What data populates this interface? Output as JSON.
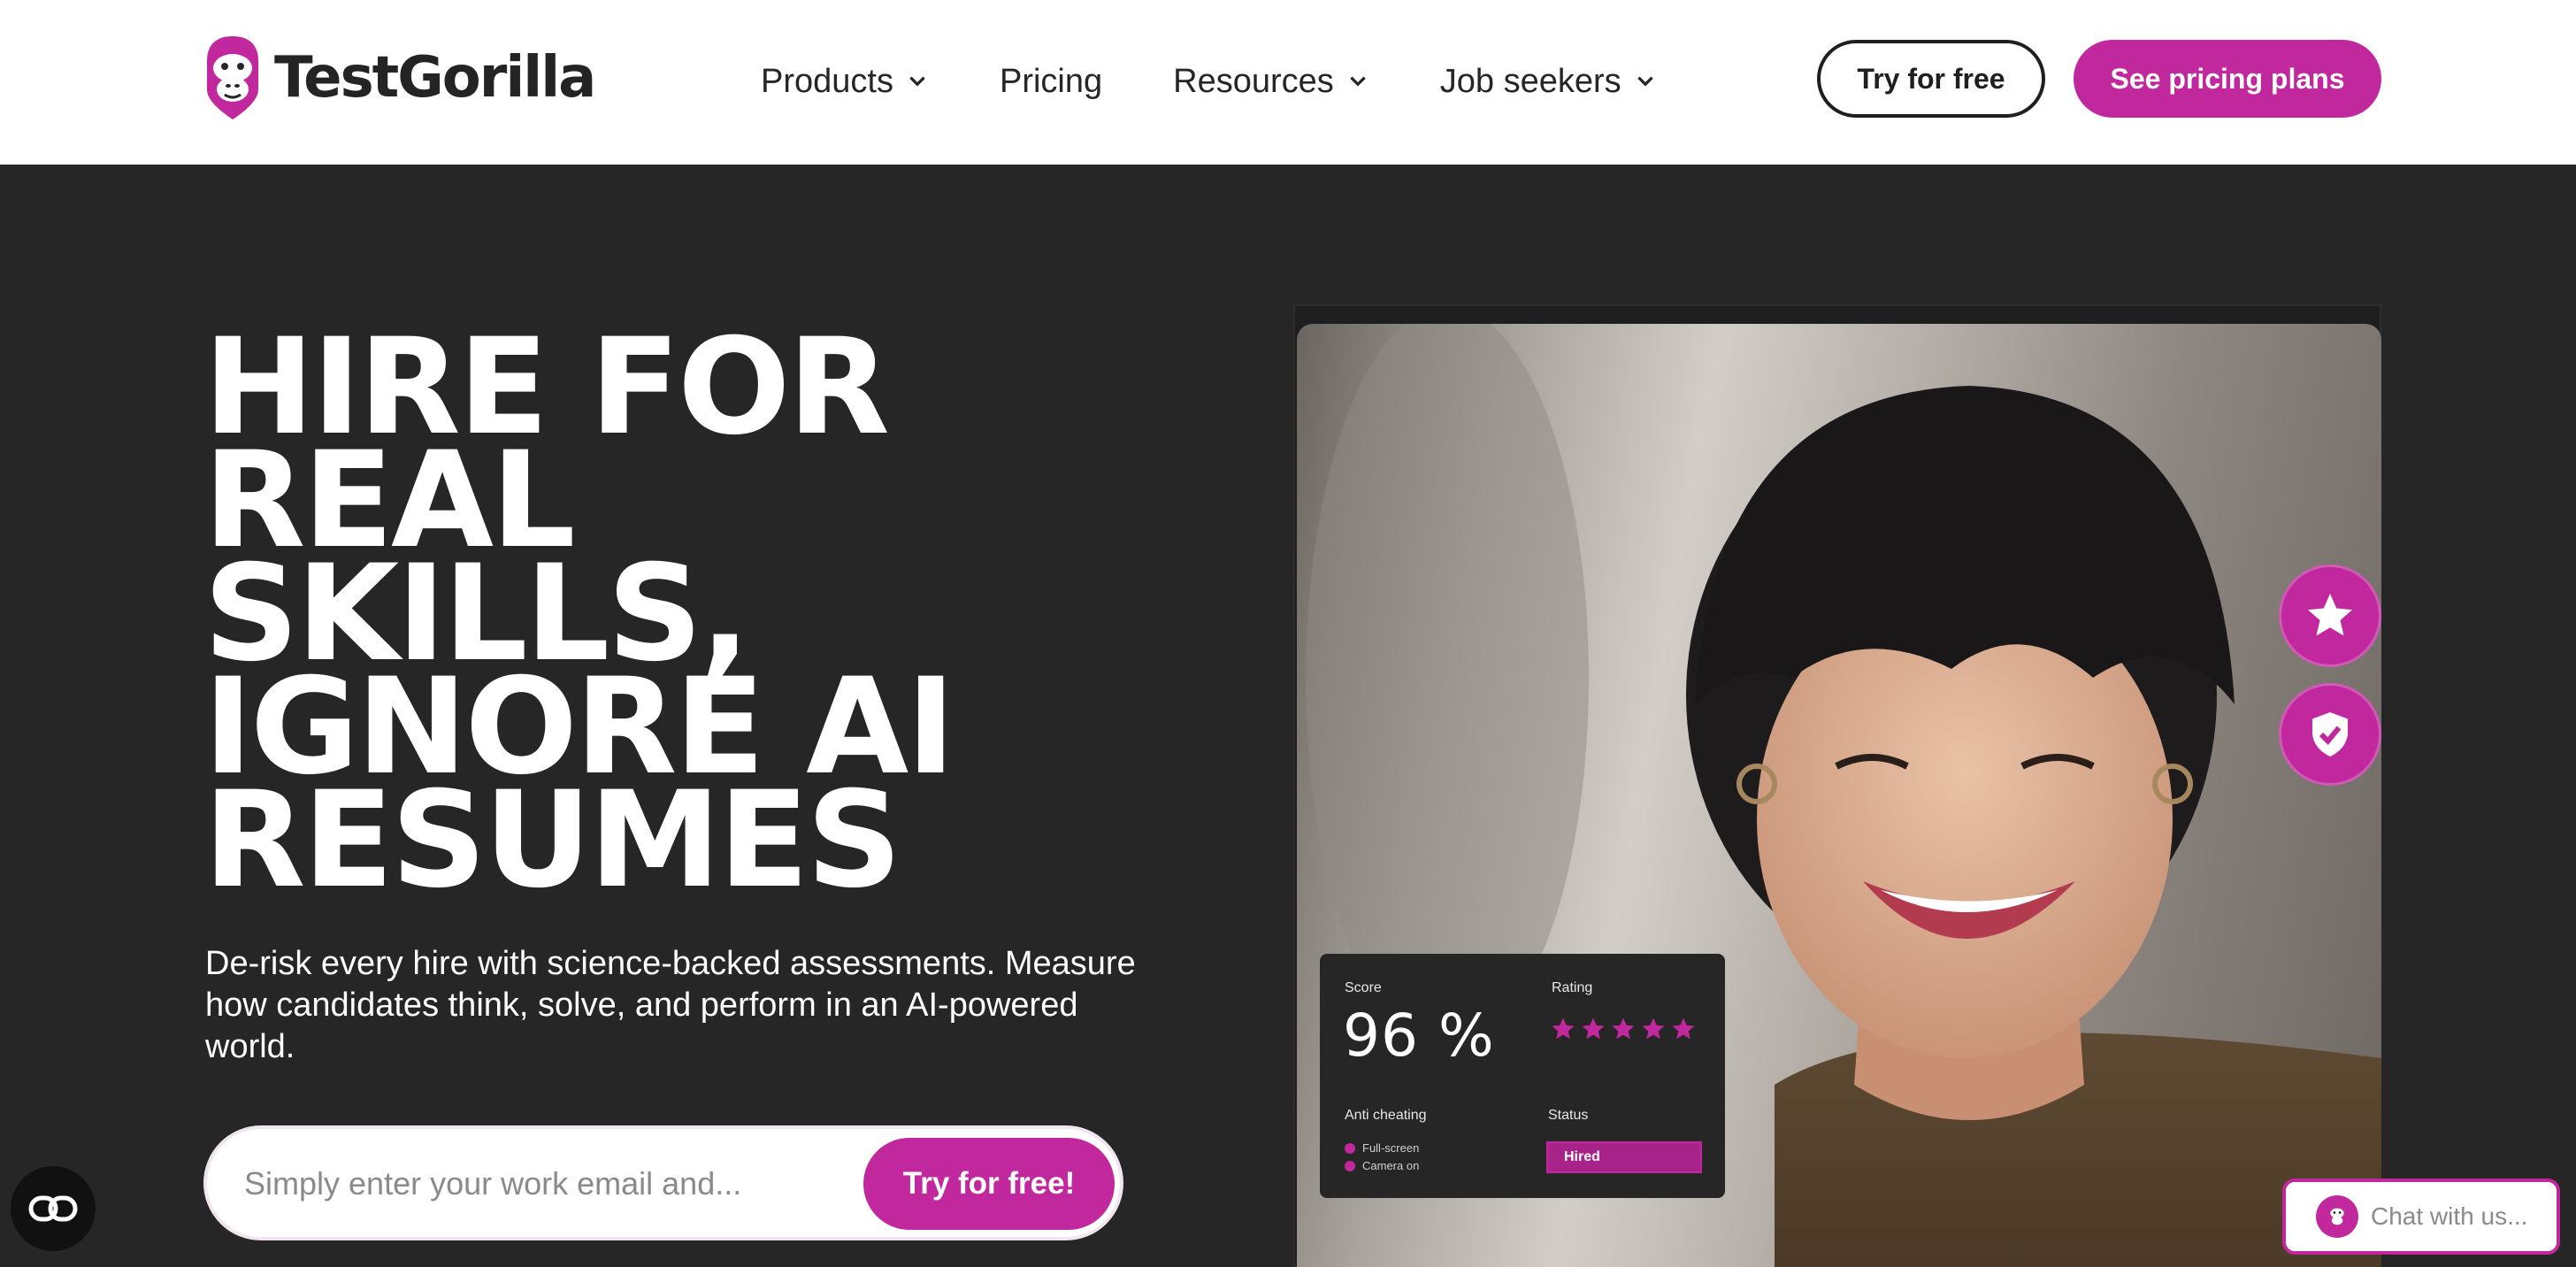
{
  "brand": {
    "name": "TestGorilla",
    "accent_color": "#c1289e",
    "dark_bg": "#262626"
  },
  "nav": {
    "items": [
      {
        "label": "Products",
        "icon": "chevron-down-icon"
      },
      {
        "label": "Pricing"
      },
      {
        "label": "Resources",
        "icon": "chevron-down-icon"
      },
      {
        "label": "Job seekers",
        "icon": "chevron-down-icon"
      }
    ],
    "try_free_label": "Try for free",
    "pricing_plans_label": "See pricing plans"
  },
  "hero": {
    "headline_lines": [
      "HIRE FOR",
      "REAL",
      "SKILLS,",
      "IGNORE AI",
      "RESUMES"
    ],
    "subtext": "De-risk every hire with science-backed assessments. Measure how candidates think, solve, and perform in an AI-powered world.",
    "email_placeholder": "Simply enter your work email and...",
    "email_button_label": "Try for free!"
  },
  "side_buttons": [
    {
      "icon": "star-icon"
    },
    {
      "icon": "shield-check-icon"
    }
  ],
  "score_card": {
    "score_label": "Score",
    "score_value": "96 %",
    "rating_label": "Rating",
    "rating_stars": 5,
    "anti_cheating_label": "Anti cheating",
    "checks": [
      "Full-screen",
      "Camera on"
    ],
    "status_label": "Status",
    "status_value": "Hired"
  },
  "accessibility": {
    "icon": "accessibility-icon"
  },
  "chat": {
    "placeholder": "Chat with us..."
  }
}
